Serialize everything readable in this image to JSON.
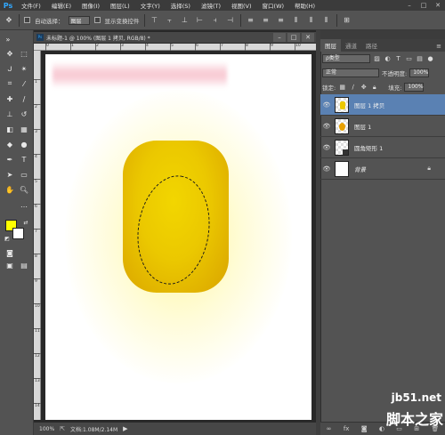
{
  "app": {
    "logo": "Ps"
  },
  "menu": [
    "文件(F)",
    "编辑(E)",
    "图像(I)",
    "图层(L)",
    "文字(Y)",
    "选择(S)",
    "滤镜(T)",
    "视图(V)",
    "窗口(W)",
    "帮助(H)"
  ],
  "window_controls": {
    "minimize": "–",
    "maximize": "□",
    "close": "✕"
  },
  "options_bar": {
    "auto_select_label": "自动选择：",
    "auto_select_value": "图层",
    "show_transform_label": "显示变换控件"
  },
  "document": {
    "tab_title": "未标题-1 @ 100% (图层 1 拷贝, RGB/8) *",
    "zoom": "100%",
    "doc_size": "文档:1.08M/2.14M"
  },
  "ruler": {
    "top": [
      "0",
      "1",
      "2",
      "3",
      "4",
      "5",
      "6",
      "7",
      "8",
      "9",
      "10"
    ],
    "left": [
      "1",
      "2",
      "3",
      "4",
      "5",
      "6",
      "7",
      "8",
      "9",
      "10",
      "11",
      "12",
      "13",
      "14"
    ]
  },
  "colors": {
    "foreground": "#ffff00",
    "background": "#ffffff",
    "shape": "#ebc800",
    "selected_layer": "#5a81b3"
  },
  "panel": {
    "tabs": [
      "图层",
      "通道",
      "路径"
    ],
    "filter_label": "ρ类型",
    "blend_mode": "正常",
    "opacity_label": "不透明度:",
    "opacity_value": "100%",
    "lock_label": "锁定:",
    "fill_label": "填充:",
    "fill_value": "100%"
  },
  "layers": [
    {
      "name": "图层 1 拷贝",
      "selected": true
    },
    {
      "name": "图层 1",
      "selected": false
    },
    {
      "name": "圆角矩形 1",
      "selected": false
    },
    {
      "name": "背景",
      "selected": false
    }
  ],
  "watermark": {
    "site": "jb51.net",
    "text": "脚本之家"
  }
}
